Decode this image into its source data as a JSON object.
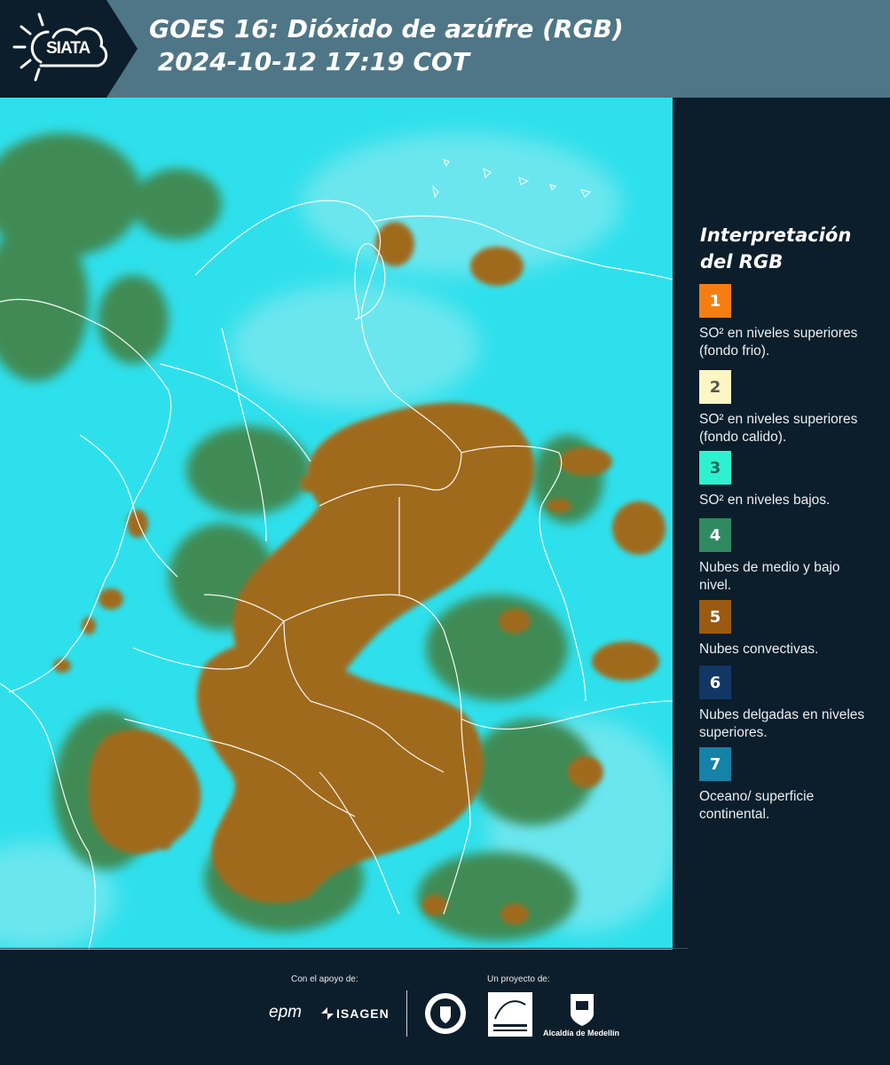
{
  "header": {
    "logo_text": "SIATA",
    "title_line1": "GOES 16: Dióxido de azúfre (RGB)",
    "title_line2": " 2024-10-12 17:19 COT"
  },
  "legend": {
    "title": "Interpretación del RGB",
    "items": [
      {
        "number": "1",
        "color": "#f57e12",
        "text_color": "#ffffff",
        "label": "SO² en niveles superiores (fondo frio)."
      },
      {
        "number": "2",
        "color": "#fff5c4",
        "text_color": "#555555",
        "label": "SO² en niveles superiores (fondo calido)."
      },
      {
        "number": "3",
        "color": "#2ef2cf",
        "text_color": "#1c6a60",
        "label": "SO² en niveles bajos."
      },
      {
        "number": "4",
        "color": "#2f8a61",
        "text_color": "#ffffff",
        "label": "Nubes de medio y bajo nivel."
      },
      {
        "number": "5",
        "color": "#9a5a12",
        "text_color": "#ffffff",
        "label": "Nubes convectivas."
      },
      {
        "number": "6",
        "color": "#123765",
        "text_color": "#ffffff",
        "label": "Nubes delgadas en niveles superiores."
      },
      {
        "number": "7",
        "color": "#1582a7",
        "text_color": "#ffffff",
        "label": "Oceano/ superficie continental."
      }
    ]
  },
  "footer": {
    "support_label": "Con el apoyo de:",
    "project_label": "Un proyecto de:",
    "sponsors": [
      "epm",
      "ISAGEN"
    ],
    "partners": [
      "Área Metropolitana Valle de Aburrá",
      "Alcaldía de Medellín"
    ]
  },
  "map": {
    "description_colors": {
      "ocean": "#2ee0ec",
      "convective": "#a06a1c",
      "midlevel": "#3e8a52"
    }
  }
}
